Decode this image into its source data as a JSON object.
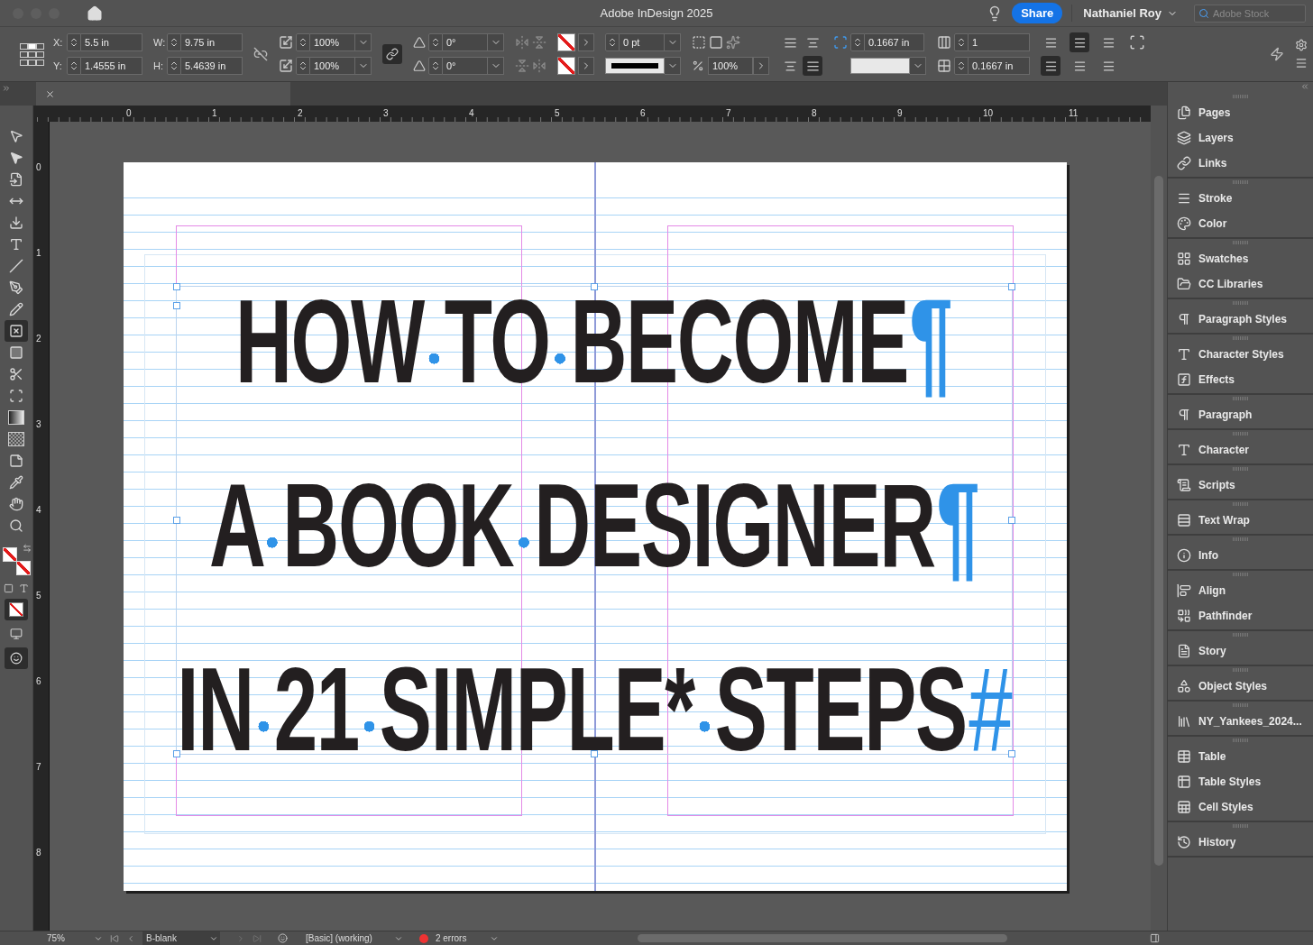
{
  "window": {
    "title": "Adobe InDesign 2025",
    "share": "Share",
    "user": "Nathaniel Roy",
    "stock_search": {
      "placeholder": "Adobe Stock"
    }
  },
  "control_bar": {
    "position": [
      {
        "label": "X:",
        "value": "5.5 in"
      },
      {
        "label": "Y:",
        "value": "1.4555 in"
      }
    ],
    "size": [
      {
        "label": "W:",
        "value": "9.75 in"
      },
      {
        "label": "H:",
        "value": "5.4639 in"
      }
    ],
    "scale": [
      "100%",
      "100%"
    ],
    "angles": [
      "0°",
      "0°"
    ],
    "stroke_weight": "0 pt",
    "opacity": "100%",
    "inset": "0.1667 in",
    "columns": "1",
    "gutter": "0.1667 in",
    "wrap_options": [
      {
        "selected": false
      },
      {
        "selected": false
      },
      {
        "selected": false
      },
      {
        "selected": true
      }
    ],
    "layout_options": [
      {
        "selected": false
      },
      {
        "selected": true
      },
      {
        "selected": false
      },
      {
        "selected": true
      },
      {
        "selected": false
      },
      {
        "selected": false
      }
    ]
  },
  "rulers": {
    "horizontal": [
      "0",
      "1",
      "2",
      "3",
      "4",
      "5",
      "6",
      "7",
      "8",
      "9",
      "10",
      "11"
    ],
    "vertical": [
      "0",
      "1",
      "2",
      "3",
      "4",
      "5",
      "6",
      "7",
      "8"
    ]
  },
  "document": {
    "lines": [
      {
        "text": "HOW TO BECOME",
        "end_mark": "¶"
      },
      {
        "text": "A BOOK DESIGNER",
        "end_mark": "¶"
      },
      {
        "text": "IN 21 SIMPLE* STEPS",
        "end_mark": "#"
      }
    ]
  },
  "tools": [
    {
      "selected": false
    },
    {
      "selected": false
    },
    {
      "selected": false
    },
    {
      "selected": false
    },
    {
      "selected": false
    },
    {
      "selected": false
    },
    {
      "selected": false
    },
    {
      "selected": false
    },
    {
      "selected": false
    },
    {
      "selected": true
    },
    {
      "selected": false
    },
    {
      "selected": false
    },
    {
      "selected": false
    },
    {
      "selected": false
    },
    {
      "selected": false
    },
    {
      "selected": false
    },
    {
      "selected": false
    },
    {
      "selected": false
    },
    {
      "selected": false
    }
  ],
  "panel_groups": [
    {
      "items": [
        "Pages",
        "Layers",
        "Links"
      ]
    },
    {
      "items": [
        "Stroke",
        "Color"
      ]
    },
    {
      "items": [
        "Swatches",
        "CC Libraries"
      ]
    },
    {
      "items": [
        "Paragraph Styles"
      ]
    },
    {
      "items": [
        "Character Styles",
        "Effects"
      ]
    },
    {
      "items": [
        "Paragraph"
      ]
    },
    {
      "items": [
        "Character"
      ]
    },
    {
      "items": [
        "Scripts"
      ]
    },
    {
      "items": [
        "Text Wrap"
      ]
    },
    {
      "items": [
        "Info"
      ]
    },
    {
      "items": [
        "Align",
        "Pathfinder"
      ]
    },
    {
      "items": [
        "Story"
      ]
    },
    {
      "items": [
        "Object Styles"
      ]
    },
    {
      "items": [
        "NY_Yankees_2024..."
      ]
    },
    {
      "items": [
        "Table",
        "Table Styles",
        "Cell Styles"
      ]
    },
    {
      "items": [
        "History"
      ]
    }
  ],
  "status_bar": {
    "zoom": "75%",
    "page": "B-blank",
    "profile": "[Basic] (working)",
    "errors": "2 errors"
  }
}
